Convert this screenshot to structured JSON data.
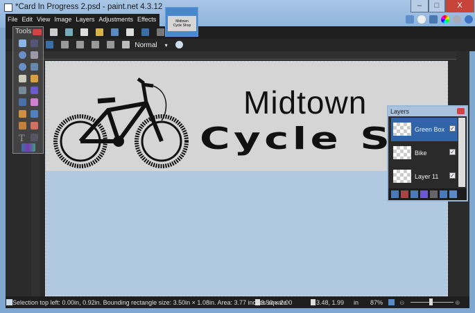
{
  "window": {
    "title": "*Card In Progress 2.psd - paint.net 4.3.12",
    "minimize": "–",
    "maximize": "□",
    "close": "X"
  },
  "menu": [
    "File",
    "Edit",
    "View",
    "Image",
    "Layers",
    "Adjustments",
    "Effects"
  ],
  "toolbar": {
    "tools_label": "Tools",
    "blend_mode": "Normal"
  },
  "document_thumb": {
    "line1": "Midtown",
    "line2": "Cycle Shop"
  },
  "canvas": {
    "title": "Midtown",
    "subtitle": "Cycle Shop"
  },
  "tools_window": {
    "title": "Tools"
  },
  "layers_window": {
    "title": "Layers",
    "layers": [
      {
        "name": "Green Box",
        "checked": "✓"
      },
      {
        "name": "Bike",
        "checked": "✓"
      },
      {
        "name": "Layer 11",
        "checked": "✓"
      }
    ]
  },
  "status": {
    "selection": "Selection top left: 0.00in, 0.92in. Bounding rectangle size: 3.50in × 1.08in. Area: 3.77 inches square",
    "image_size": "3.50 × 2.00",
    "cursor": "3.48, 1.99",
    "units": "in",
    "zoom": "87%"
  },
  "colors": {
    "accent": "#3a6ea8",
    "canvas_top": "#d5d5d5",
    "canvas_bottom": "#b1c8e1"
  }
}
